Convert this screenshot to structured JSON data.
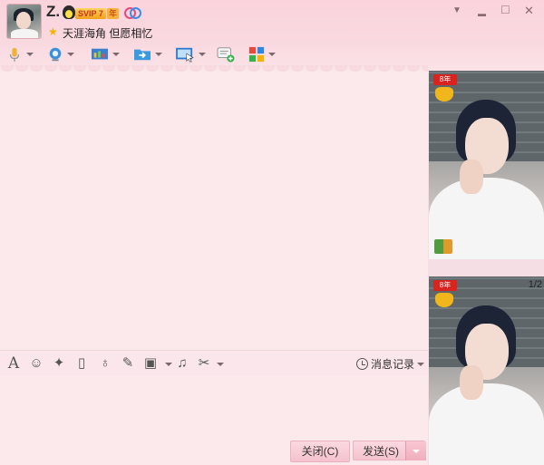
{
  "profile": {
    "nickname": "Z.",
    "svip_label": "SVIP 7",
    "year_label": "年",
    "signature": "天涯海角 但愿相忆"
  },
  "window_controls": {
    "dropdown": "▼",
    "minimize": "▬",
    "maximize": "□",
    "close": "✕"
  },
  "chat_toolbar": {
    "icons": [
      "microphone-icon",
      "video-call-icon",
      "screen-share-icon",
      "file-transfer-icon",
      "remote-desktop-icon",
      "chat-add-icon",
      "apps-icon"
    ]
  },
  "input_toolbar": {
    "history_label": "消息记录"
  },
  "buttons": {
    "close_label": "关闭(C)",
    "send_label": "发送(S)"
  },
  "right_panel": {
    "badge_text": "8年",
    "page_indicator": "1/2"
  },
  "colors": {
    "accent_pink": "#f5c3cd",
    "background": "#fbe9ec"
  }
}
